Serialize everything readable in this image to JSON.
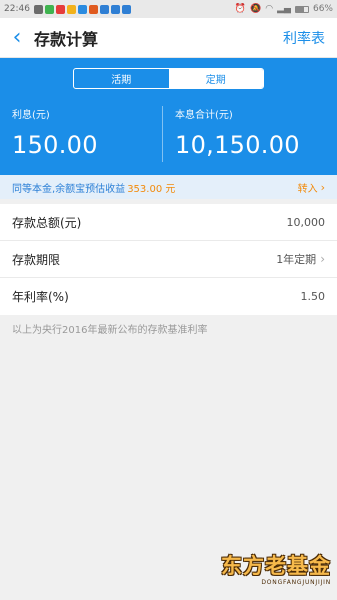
{
  "status_bar": {
    "time": "22:46",
    "battery": "66%",
    "battery_level": 0.66,
    "notification_icon_colors": [
      "#6b6b6b",
      "#3fb34f",
      "#e63b3b",
      "#f2b21b",
      "#2a8be0",
      "#e05a1f",
      "#2f7fd4",
      "#2f7fd4",
      "#2f7fd4"
    ]
  },
  "navbar": {
    "title": "存款计算",
    "right_link": "利率表"
  },
  "segment": {
    "tabs": [
      {
        "label": "活期",
        "active": false
      },
      {
        "label": "定期",
        "active": true
      }
    ]
  },
  "summary": {
    "interest_label": "利息(元)",
    "interest_value": "150.00",
    "total_label": "本息合计(元)",
    "total_value": "10,150.00"
  },
  "tip": {
    "text": "同等本金,余额宝预估收益",
    "amount": "353.00 元",
    "action": "转入"
  },
  "form": {
    "rows": [
      {
        "label": "存款总额(元)",
        "value": "10,000"
      },
      {
        "label": "存款期限",
        "value": "1年定期"
      },
      {
        "label": "年利率(%)",
        "value": "1.50"
      }
    ]
  },
  "note": "以上为央行2016年最新公布的存款基准利率",
  "watermark": {
    "text": "东方老基金",
    "subtext": "DONGFANGJUNJIJIN"
  },
  "colors": {
    "accent": "#1b8ee8",
    "orange": "#f28b0c",
    "tip_bg": "#e4effa"
  }
}
